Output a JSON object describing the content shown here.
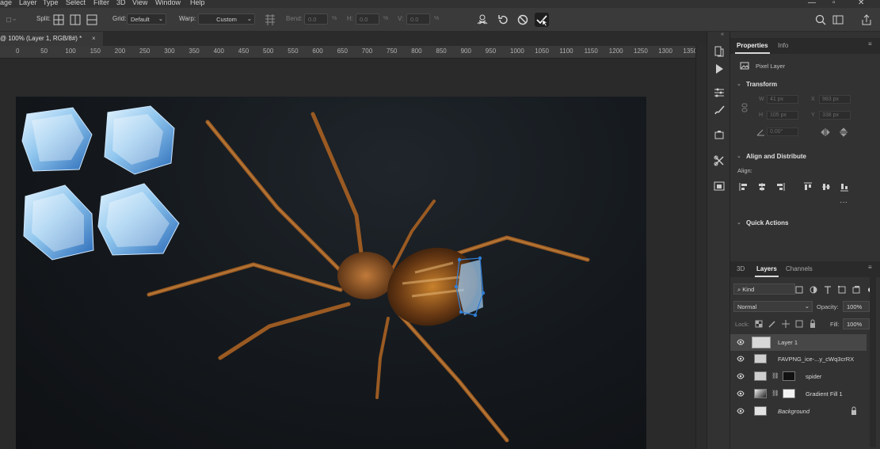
{
  "menu": [
    "age",
    "Layer",
    "Type",
    "Select",
    "Filter",
    "3D",
    "View",
    "Window",
    "Help"
  ],
  "options_bar": {
    "split_label": "Split:",
    "grid_label": "Grid:",
    "grid_value": "Default",
    "warp_label": "Warp:",
    "warp_value": "Custom",
    "bend_label": "Bend:",
    "bend_value": "0.0",
    "h_label": "H:",
    "h_value": "0.0",
    "v_label": "V:",
    "v_value": "0.0",
    "unit": "%"
  },
  "document_tab": {
    "title": "@ 100% (Layer 1, RGB/8#) *",
    "close": "×"
  },
  "ruler_marks": [
    "0",
    "50",
    "100",
    "150",
    "200",
    "250",
    "300",
    "350",
    "400",
    "450",
    "500",
    "550",
    "600",
    "650",
    "700",
    "750",
    "800",
    "850",
    "900",
    "950",
    "1000",
    "1050",
    "1100",
    "1150",
    "1200",
    "1250",
    "1300",
    "1350"
  ],
  "properties": {
    "tabs": [
      "Properties",
      "Info"
    ],
    "layer_kind": "Pixel Layer",
    "transform": {
      "title": "Transform",
      "w_label": "W",
      "w_value": "41 px",
      "x_label": "X",
      "x_value": "983 px",
      "h_label": "H",
      "h_value": "105 px",
      "y_label": "Y",
      "y_value": "338 px",
      "angle_value": "0.00°"
    },
    "align": {
      "title": "Align and Distribute",
      "align_label": "Align:"
    },
    "quick_actions": "Quick Actions"
  },
  "layers_panel": {
    "tabs": [
      "3D",
      "Layers",
      "Channels"
    ],
    "filter_kind": "Kind",
    "blend_mode": "Normal",
    "opacity_label": "Opacity:",
    "opacity_value": "100%",
    "lock_label": "Lock:",
    "fill_label": "Fill:",
    "fill_value": "100%",
    "layers": [
      {
        "name": "Layer 1"
      },
      {
        "name": "FAVPNG_ice-...y_cWq3crRX"
      },
      {
        "name": "spider"
      },
      {
        "name": "Gradient Fill 1"
      },
      {
        "name": "Background"
      }
    ]
  },
  "colors": {
    "accent": "#2f7fd8",
    "panel_bg": "#323232",
    "canvas_bg": "#2a2a2a"
  }
}
